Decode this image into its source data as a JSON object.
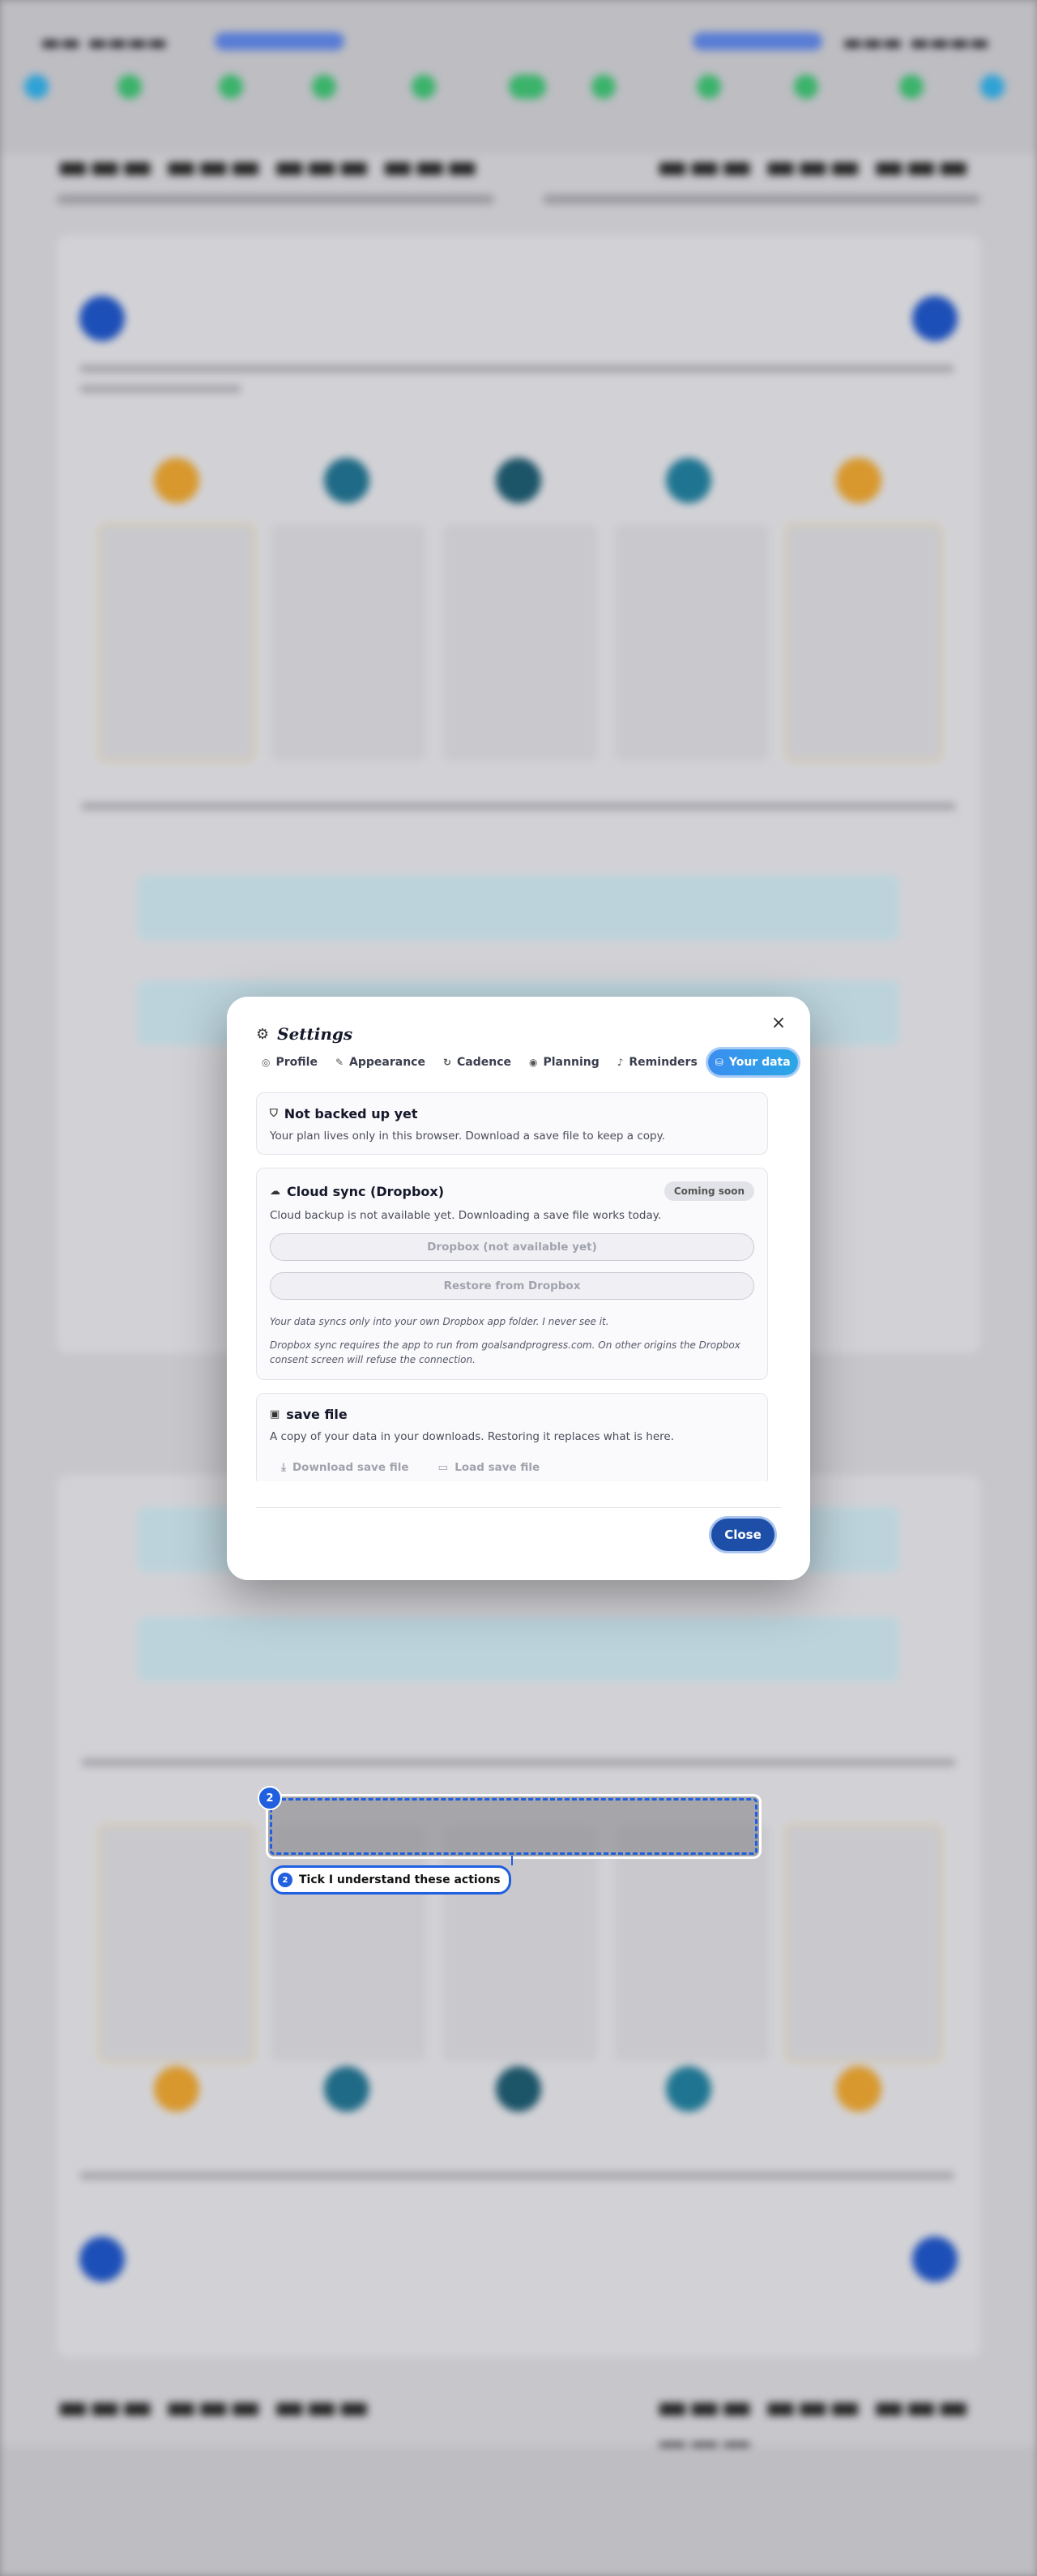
{
  "modal": {
    "title": "Settings",
    "tabs": [
      {
        "label": "Profile",
        "icon": "user-icon"
      },
      {
        "label": "Appearance",
        "icon": "brush-icon"
      },
      {
        "label": "Cadence",
        "icon": "refresh-icon"
      },
      {
        "label": "Planning",
        "icon": "target-icon"
      },
      {
        "label": "Reminders",
        "icon": "bell-icon"
      },
      {
        "label": "Your data",
        "icon": "database-icon",
        "active": true
      }
    ],
    "backup": {
      "title": "Not backed up yet",
      "text": "Your plan lives only in this browser. Download a save file to keep a copy."
    },
    "cloud": {
      "title": "Cloud sync (Dropbox)",
      "badge": "Coming soon",
      "text": "Cloud backup is not available yet. Downloading a save file works today.",
      "connect_button": "Dropbox (not available yet)",
      "restore_button": "Restore from Dropbox",
      "note1": "Your data syncs only into your own Dropbox app folder. I never see it.",
      "note2": "Dropbox sync requires the app to run from goalsandprogress.com. On other origins the Dropbox consent screen will refuse the connection."
    },
    "savefile": {
      "title": "save file",
      "text": "A copy of your data in your downloads. Restoring it replaces what is here.",
      "download_button": "Download save file",
      "load_button": "Load save file"
    },
    "close_button": "Close"
  },
  "tutorial": {
    "step_number": "2",
    "tip": "Tick I understand these actions"
  },
  "colors": {
    "accent": "#2ba6e6",
    "primary_button": "#1d4fa8",
    "highlight": "#1f5fe0"
  }
}
